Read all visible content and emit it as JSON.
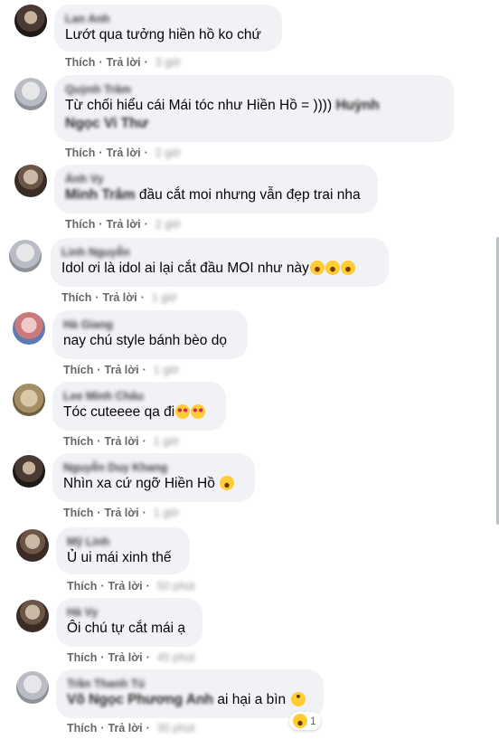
{
  "labels": {
    "like": "Thích",
    "reply": "Trả lời"
  },
  "comments": [
    {
      "name": "Lan Anh",
      "text": "Lướt qua tưởng hiền hồ ko chứ",
      "time": "3 giờ"
    },
    {
      "name": "Quỳnh Trâm",
      "text_line1": "Từ chối hiểu cái Mái tóc như Hiền Hồ = ))))",
      "mention_line1": "Huỳnh",
      "mention_line2": "Ngọc Vi Thư",
      "time": "2 giờ"
    },
    {
      "name": "Ánh Vy",
      "mention": "Minh Trâm",
      "text": " đầu cắt moi nhưng vẫn đẹp trai nha",
      "time": "2 giờ"
    },
    {
      "name": "Linh Nguyễn",
      "text": "Idol ơi là idol ai lại cắt đầu MOI như này",
      "emoji": "rolling-on-floor-laughing",
      "time": "1 giờ"
    },
    {
      "name": "Hà Giang",
      "text": "nay chú style bánh bèo dọ",
      "time": "1 giờ"
    },
    {
      "name": "Lee Minh Châu",
      "text": "Tóc cuteeee qa đi",
      "emoji": "smiling-face-with-hearts",
      "time": "1 giờ"
    },
    {
      "name": "Nguyễn Duy Khang",
      "text": "Nhìn xa cứ ngỡ Hiền Hồ",
      "emoji": "grinning-squinting-face",
      "time": "1 giờ"
    },
    {
      "name": "Mỹ Linh",
      "text": "Ủ ui mái xinh thế",
      "time": "50 phút"
    },
    {
      "name": "Hà Vy",
      "text": "Ôi chú tự cắt mái ạ",
      "time": "45 phút"
    },
    {
      "name": "Trần Thanh Tú",
      "mention": "Võ Ngọc Phương Anh",
      "text": " ai hại a bìn",
      "emoji": "upside-down-face",
      "reaction_icon": "grinning-squinting-face",
      "reaction_count": "1",
      "time": "30 phút"
    }
  ]
}
